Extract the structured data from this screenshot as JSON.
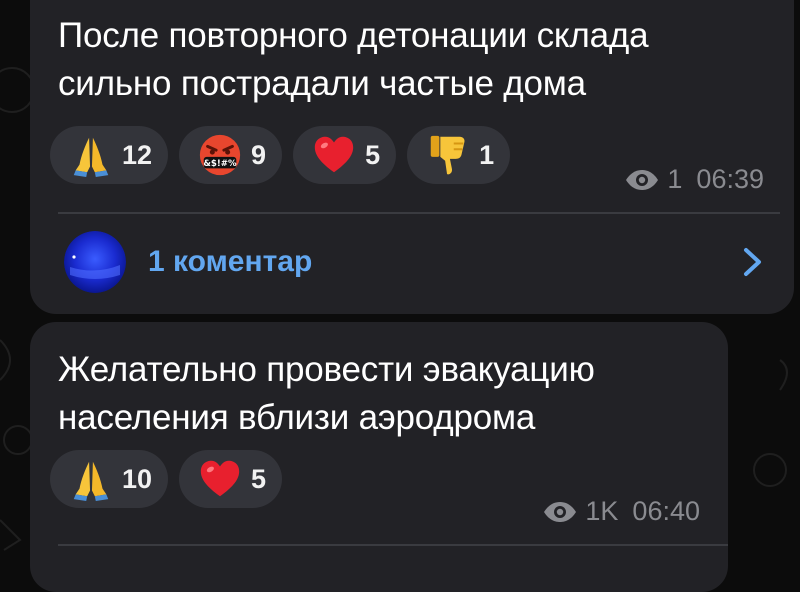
{
  "messages": [
    {
      "text_lines": [
        "После повторного детонации склада",
        "сильно пострадали частые дома"
      ],
      "reactions": [
        {
          "emoji": "folded-hands",
          "count": "12"
        },
        {
          "emoji": "face-with-symbols-on-mouth",
          "symbols": "&$!#%",
          "count": "9"
        },
        {
          "emoji": "red-heart",
          "count": "5"
        },
        {
          "emoji": "thumbs-down",
          "count": "1"
        }
      ],
      "views": "1",
      "time": "06:39",
      "comments_label": "1 коментар"
    },
    {
      "text_lines": [
        "Желательно провести эвакуацию",
        "населения вблизи аэродрома"
      ],
      "reactions": [
        {
          "emoji": "folded-hands",
          "count": "10"
        },
        {
          "emoji": "red-heart",
          "count": "5"
        }
      ],
      "views": "1K",
      "time": "06:40"
    }
  ],
  "colors": {
    "background": "#0c0c0c",
    "bubble": "#222226",
    "reaction_pill": "#33343a",
    "link": "#62a7f0",
    "meta": "#8a8b90"
  }
}
